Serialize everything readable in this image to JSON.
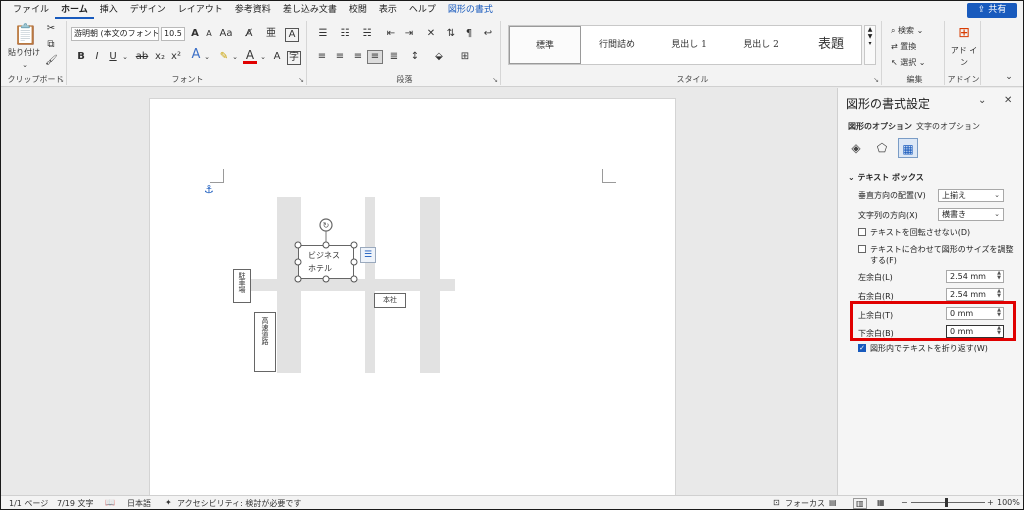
{
  "menu": {
    "tabs": [
      "ファイル",
      "ホーム",
      "挿入",
      "デザイン",
      "レイアウト",
      "参考資料",
      "差し込み文書",
      "校閲",
      "表示",
      "ヘルプ",
      "図形の書式"
    ],
    "share": "共有"
  },
  "ribbon": {
    "clipboard": {
      "paste": "貼り付け",
      "label": "クリップボード"
    },
    "font": {
      "name": "游明朝 (本文のフォント",
      "size": "10.5",
      "label": "フォント"
    },
    "paragraph": {
      "label": "段落"
    },
    "styles": {
      "items": [
        "標準",
        "行間詰め",
        "見出し 1",
        "見出し 2",
        "表題"
      ],
      "label": "スタイル"
    },
    "editing": {
      "find": "検索",
      "replace": "置換",
      "select": "選択",
      "label": "編集"
    },
    "addins": {
      "addin": "アド イン",
      "label": "アドイン"
    }
  },
  "document": {
    "textbox_main": "ビジネス ホテル",
    "label_a": "駐車場",
    "label_b": "本社",
    "label_c": "高速道路"
  },
  "pane": {
    "title": "図形の書式設定",
    "tab_shape": "図形のオプション",
    "tab_text": "文字のオプション",
    "section": "テキスト ボックス",
    "valign_label": "垂直方向の配置(V)",
    "valign_value": "上揃え",
    "textdir_label": "文字列の方向(X)",
    "textdir_value": "横書き",
    "norotate": "テキストを回転させない(D)",
    "autofit": "テキストに合わせて図形のサイズを調整する(F)",
    "left_label": "左余白(L)",
    "left_value": "2.54 mm",
    "right_label": "右余白(R)",
    "right_value": "2.54 mm",
    "top_label": "上余白(T)",
    "top_value": "0 mm",
    "bottom_label": "下余白(B)",
    "bottom_value": "0 mm",
    "wrap": "図形内でテキストを折り返す(W)"
  },
  "status": {
    "page": "1/1 ページ",
    "words": "7/19 文字",
    "lang": "日本語",
    "access": "アクセシビリティ: 検討が必要です",
    "focus": "フォーカス",
    "zoom": "100%"
  }
}
